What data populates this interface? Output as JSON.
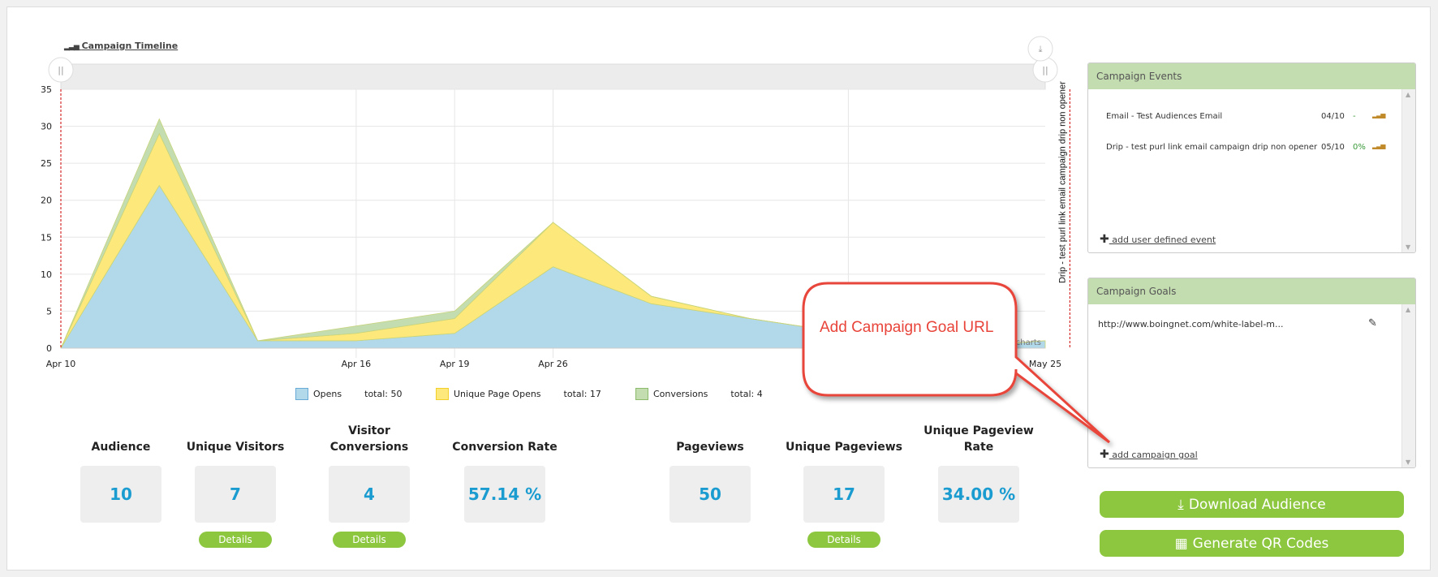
{
  "timeline": {
    "title": "Campaign Timeline",
    "icon": "bar-chart-icon"
  },
  "chart_data": {
    "type": "area",
    "stacked": true,
    "title": "",
    "x_points": 11,
    "tick_labels": [
      {
        "index": 0,
        "label": "Apr 10"
      },
      {
        "index": 3,
        "label": "Apr 16"
      },
      {
        "index": 4,
        "label": "Apr 19"
      },
      {
        "index": 5,
        "label": "Apr 26"
      },
      {
        "index": 10,
        "label": "May 25"
      }
    ],
    "ylim": [
      0,
      35
    ],
    "yticks": [
      0,
      5,
      10,
      15,
      20,
      25,
      30,
      35
    ],
    "grid": true,
    "series": [
      {
        "name": "Opens",
        "values": [
          0,
          22,
          1,
          1,
          2,
          11,
          6,
          4,
          2,
          0,
          1
        ],
        "color": "#b1d9ea",
        "total_label": "total: 50"
      },
      {
        "name": "Unique Page Opens",
        "values": [
          0,
          7,
          0,
          1,
          2,
          6,
          1,
          0,
          0,
          0,
          0
        ],
        "color": "#fde87c",
        "total_label": "total: 17"
      },
      {
        "name": "Conversions",
        "values": [
          0,
          2,
          0,
          1,
          1,
          0,
          0,
          0,
          0,
          0,
          0
        ],
        "color": "#c3dcb0",
        "total_label": "total: 4"
      }
    ],
    "plot_lines": [
      {
        "index": 0,
        "label": ""
      },
      {
        "index": 10.25,
        "label": "Drip - test purl link email campaign drip non opener"
      }
    ],
    "legend_position": "bottom",
    "credits": "Highcharts"
  },
  "stats": [
    {
      "title": "Audience",
      "value": "10"
    },
    {
      "title": "Unique Visitors",
      "value": "7",
      "details": "Details"
    },
    {
      "title": "Visitor Conversions",
      "value": "4",
      "details": "Details"
    },
    {
      "title": "Conversion Rate",
      "value": "57.14 %"
    },
    {
      "title": "Pageviews",
      "value": "50"
    },
    {
      "title": "Unique Pageviews",
      "value": "17",
      "details": "Details"
    },
    {
      "title": "Unique Pageview Rate",
      "value": "34.00 %"
    }
  ],
  "events": {
    "title": "Campaign Events",
    "items": [
      {
        "name": "Email - Test Audiences Email",
        "date": "04/10",
        "rate": "-"
      },
      {
        "name": "Drip - test purl link email campaign drip non opener",
        "date": "05/10",
        "rate": "0%"
      }
    ],
    "add_label": " add user defined event"
  },
  "goals": {
    "title": "Campaign Goals",
    "items": [
      {
        "url": "http://www.boingnet.com/white-label-m..."
      }
    ],
    "add_label": " add campaign goal"
  },
  "buttons": {
    "download": "Download Audience",
    "qr": "Generate QR Codes"
  },
  "callout": {
    "text": "Add Campaign Goal URL"
  },
  "colors": {
    "accent_green": "#8dc63f",
    "panel_header": "#c3dcb0",
    "value_blue": "#1b9cd0",
    "callout_red": "#e8443a"
  }
}
